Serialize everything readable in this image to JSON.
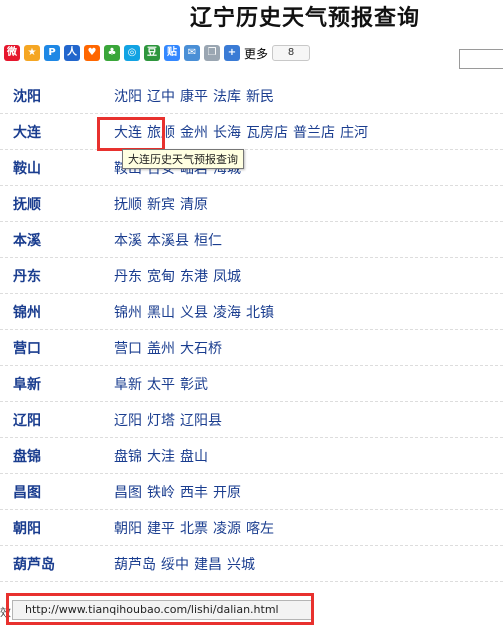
{
  "page": {
    "title": "辽宁历史天气预报查询"
  },
  "share_bar": {
    "icons": [
      {
        "name": "sina-weibo-icon",
        "color": "#e6162d",
        "glyph": "微"
      },
      {
        "name": "qzone-icon",
        "color": "#f5a623",
        "glyph": "★"
      },
      {
        "name": "tencent-p-icon",
        "color": "#1e88e5",
        "glyph": "P"
      },
      {
        "name": "renren-icon",
        "color": "#2266cc",
        "glyph": "人"
      },
      {
        "name": "kaixin-icon",
        "color": "#ff6600",
        "glyph": "♥"
      },
      {
        "name": "clover-icon",
        "color": "#3aa63a",
        "glyph": "♣"
      },
      {
        "name": "qq-icon",
        "color": "#12a3e3",
        "glyph": "◎"
      },
      {
        "name": "douban-icon",
        "color": "#2e963d",
        "glyph": "豆"
      },
      {
        "name": "tieba-icon",
        "color": "#3388ff",
        "glyph": "贴"
      },
      {
        "name": "email-icon",
        "color": "#4a8fd6",
        "glyph": "✉"
      },
      {
        "name": "copy-icon",
        "color": "#9aa6b2",
        "glyph": "❐"
      },
      {
        "name": "plus-icon",
        "color": "#3a7bd5",
        "glyph": "+"
      }
    ],
    "more_label": "更多",
    "count": "8"
  },
  "provinces": [
    {
      "name": "沈阳",
      "cities": [
        "沈阳",
        "辽中",
        "康平",
        "法库",
        "新民"
      ]
    },
    {
      "name": "大连",
      "cities": [
        "大连",
        "旅顺",
        "金州",
        "长海",
        "瓦房店",
        "普兰店",
        "庄河"
      ]
    },
    {
      "name": "鞍山",
      "cities": [
        "鞍山",
        "台安",
        "岫岩",
        "海城"
      ]
    },
    {
      "name": "抚顺",
      "cities": [
        "抚顺",
        "新宾",
        "清原"
      ]
    },
    {
      "name": "本溪",
      "cities": [
        "本溪",
        "本溪县",
        "桓仁"
      ]
    },
    {
      "name": "丹东",
      "cities": [
        "丹东",
        "宽甸",
        "东港",
        "凤城"
      ]
    },
    {
      "name": "锦州",
      "cities": [
        "锦州",
        "黑山",
        "义县",
        "凌海",
        "北镇"
      ]
    },
    {
      "name": "营口",
      "cities": [
        "营口",
        "盖州",
        "大石桥"
      ]
    },
    {
      "name": "阜新",
      "cities": [
        "阜新",
        "太平",
        "彰武"
      ]
    },
    {
      "name": "辽阳",
      "cities": [
        "辽阳",
        "灯塔",
        "辽阳县"
      ]
    },
    {
      "name": "盘锦",
      "cities": [
        "盘锦",
        "大洼",
        "盘山"
      ]
    },
    {
      "name": "昌图",
      "cities": [
        "昌图",
        "铁岭",
        "西丰",
        "开原"
      ]
    },
    {
      "name": "朝阳",
      "cities": [
        "朝阳",
        "建平",
        "北票",
        "凌源",
        "喀左"
      ]
    },
    {
      "name": "葫芦岛",
      "cities": [
        "葫芦岛",
        "绥中",
        "建昌",
        "兴城"
      ]
    }
  ],
  "tooltip": {
    "text": "大连历史天气预报查询"
  },
  "status_bar": {
    "url": "http://www.tianqihoubao.com/lishi/dalian.html",
    "left_fragment": "效"
  }
}
